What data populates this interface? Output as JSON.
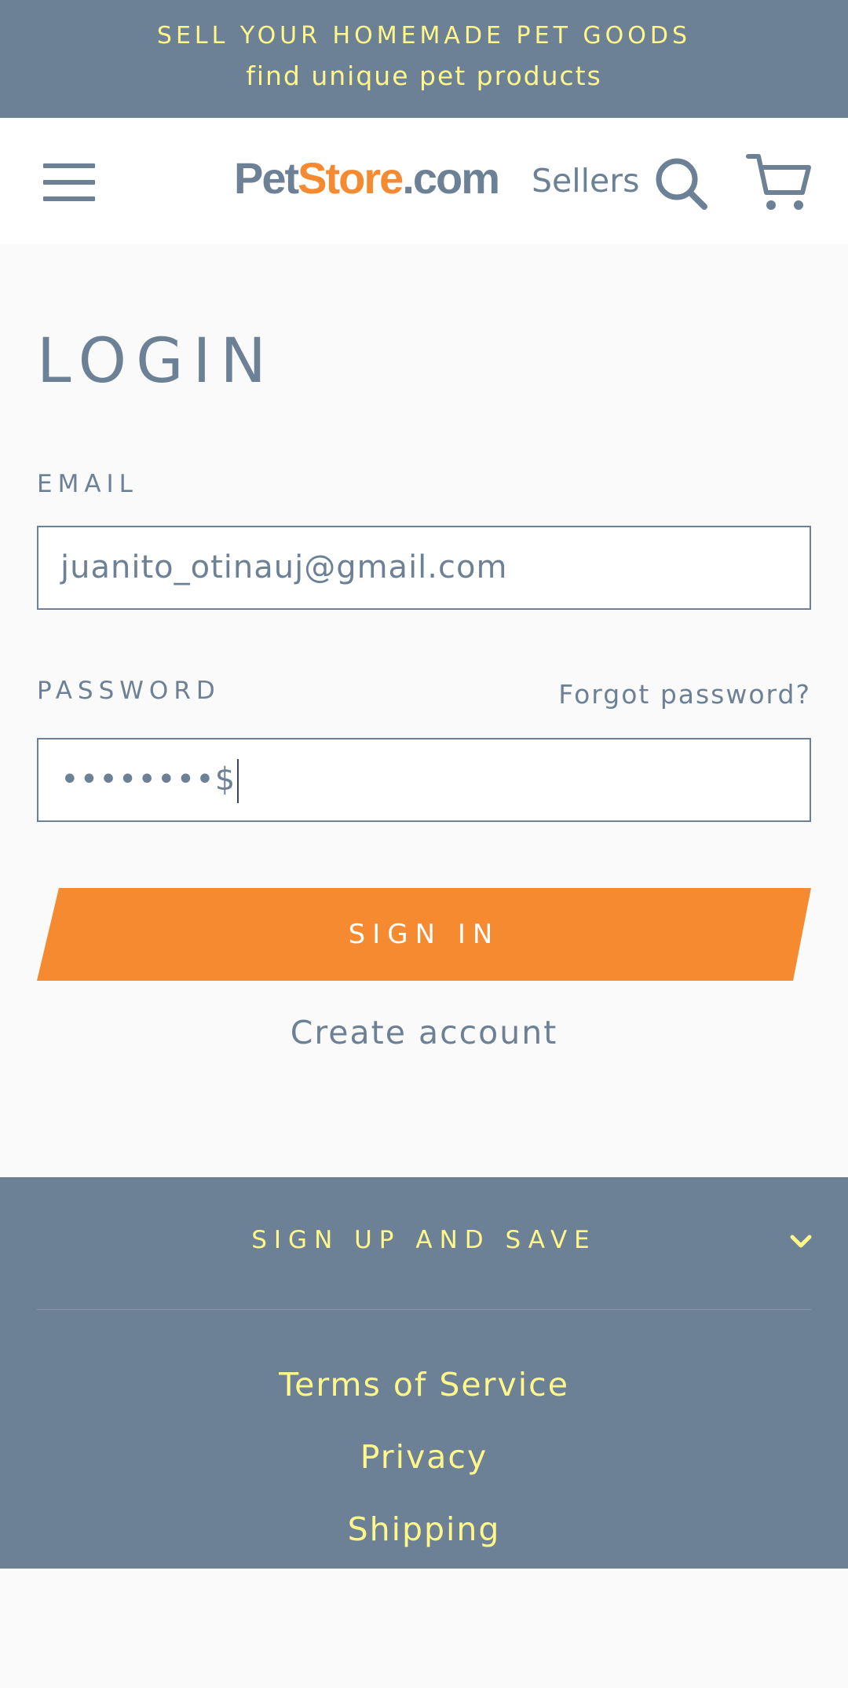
{
  "announcement": {
    "line1": "SELL YOUR HOMEMADE PET GOODS",
    "line2": "find unique pet products"
  },
  "header": {
    "logo": {
      "part1": "Pet",
      "part2": "Store",
      "part3": ".com"
    },
    "sellers_label": "Sellers",
    "icons": {
      "menu": "hamburger-icon",
      "search": "search-icon",
      "cart": "cart-icon"
    }
  },
  "login": {
    "title": "LOGIN",
    "email_label": "EMAIL",
    "email_value": "juanito_otinauj@gmail.com",
    "password_label": "PASSWORD",
    "password_value": "••••••••$",
    "forgot_label": "Forgot password?",
    "signin_label": "SIGN IN",
    "create_account_label": "Create account"
  },
  "footer": {
    "signup_label": "SIGN UP AND SAVE",
    "links": [
      "Terms of Service",
      "Privacy",
      "Shipping"
    ]
  },
  "colors": {
    "slate": "#6d8196",
    "accent_orange": "#f68a30",
    "footer_text": "#fff78a",
    "background": "#fafafa"
  }
}
